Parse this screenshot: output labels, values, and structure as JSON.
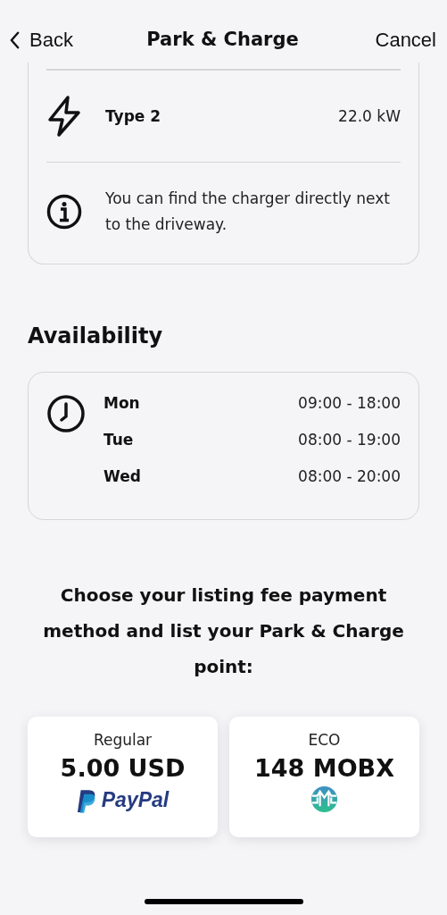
{
  "nav": {
    "back": "Back",
    "title": "Park & Charge",
    "cancel": "Cancel"
  },
  "charger": {
    "type": "Type 2",
    "power": "22.0 kW",
    "note": "You can find the charger directly next to the driveway."
  },
  "availability": {
    "title": "Availability",
    "days": [
      {
        "day": "Mon",
        "hours": "09:00 - 18:00"
      },
      {
        "day": "Tue",
        "hours": "08:00 - 19:00"
      },
      {
        "day": "Wed",
        "hours": "08:00 - 20:00"
      }
    ]
  },
  "prompt": "Choose your listing fee payment method and list your Park & Charge point:",
  "payment_options": [
    {
      "kind": "paypal",
      "label": "Regular",
      "price": "5.00 USD",
      "brand": "PayPal"
    },
    {
      "kind": "mobx",
      "label": "ECO",
      "price": "148 MOBX"
    }
  ]
}
